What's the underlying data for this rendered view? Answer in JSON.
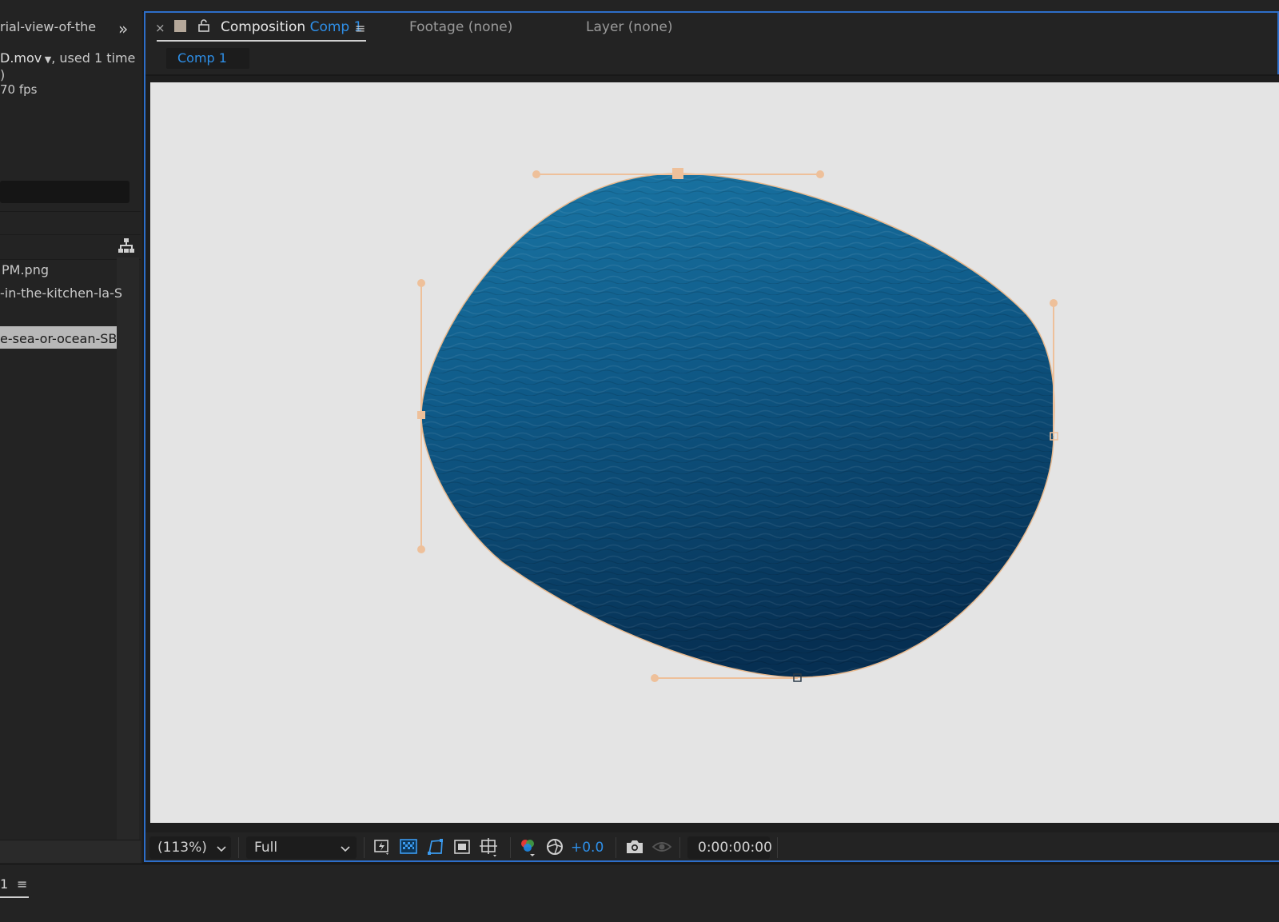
{
  "project": {
    "item_name_fragment": "rial-view-of-the",
    "file_name": "D.mov",
    "used_text": ", used 1 time",
    "paren": ")",
    "fps": "70 fps",
    "items": [
      {
        "label": "PM.png"
      },
      {
        "label": "-in-the-kitchen-la-S"
      },
      {
        "label": "e-sea-or-ocean-SB",
        "selected": true
      }
    ]
  },
  "comp_tabs": {
    "composition_label": "Composition",
    "comp_name": "Comp 1",
    "footage_label": "Footage (none)",
    "layer_label": "Layer (none)",
    "sub_tab": "Comp 1"
  },
  "viewer_bar": {
    "zoom": "(113%)",
    "resolution": "Full",
    "exposure": "+0.0",
    "timecode": "0:00:00:00"
  },
  "timeline": {
    "tab_label": "1"
  },
  "colors": {
    "accent_blue": "#2e8fe8",
    "panel_border": "#2d6ec9",
    "mask_path": "#e8b98e"
  }
}
